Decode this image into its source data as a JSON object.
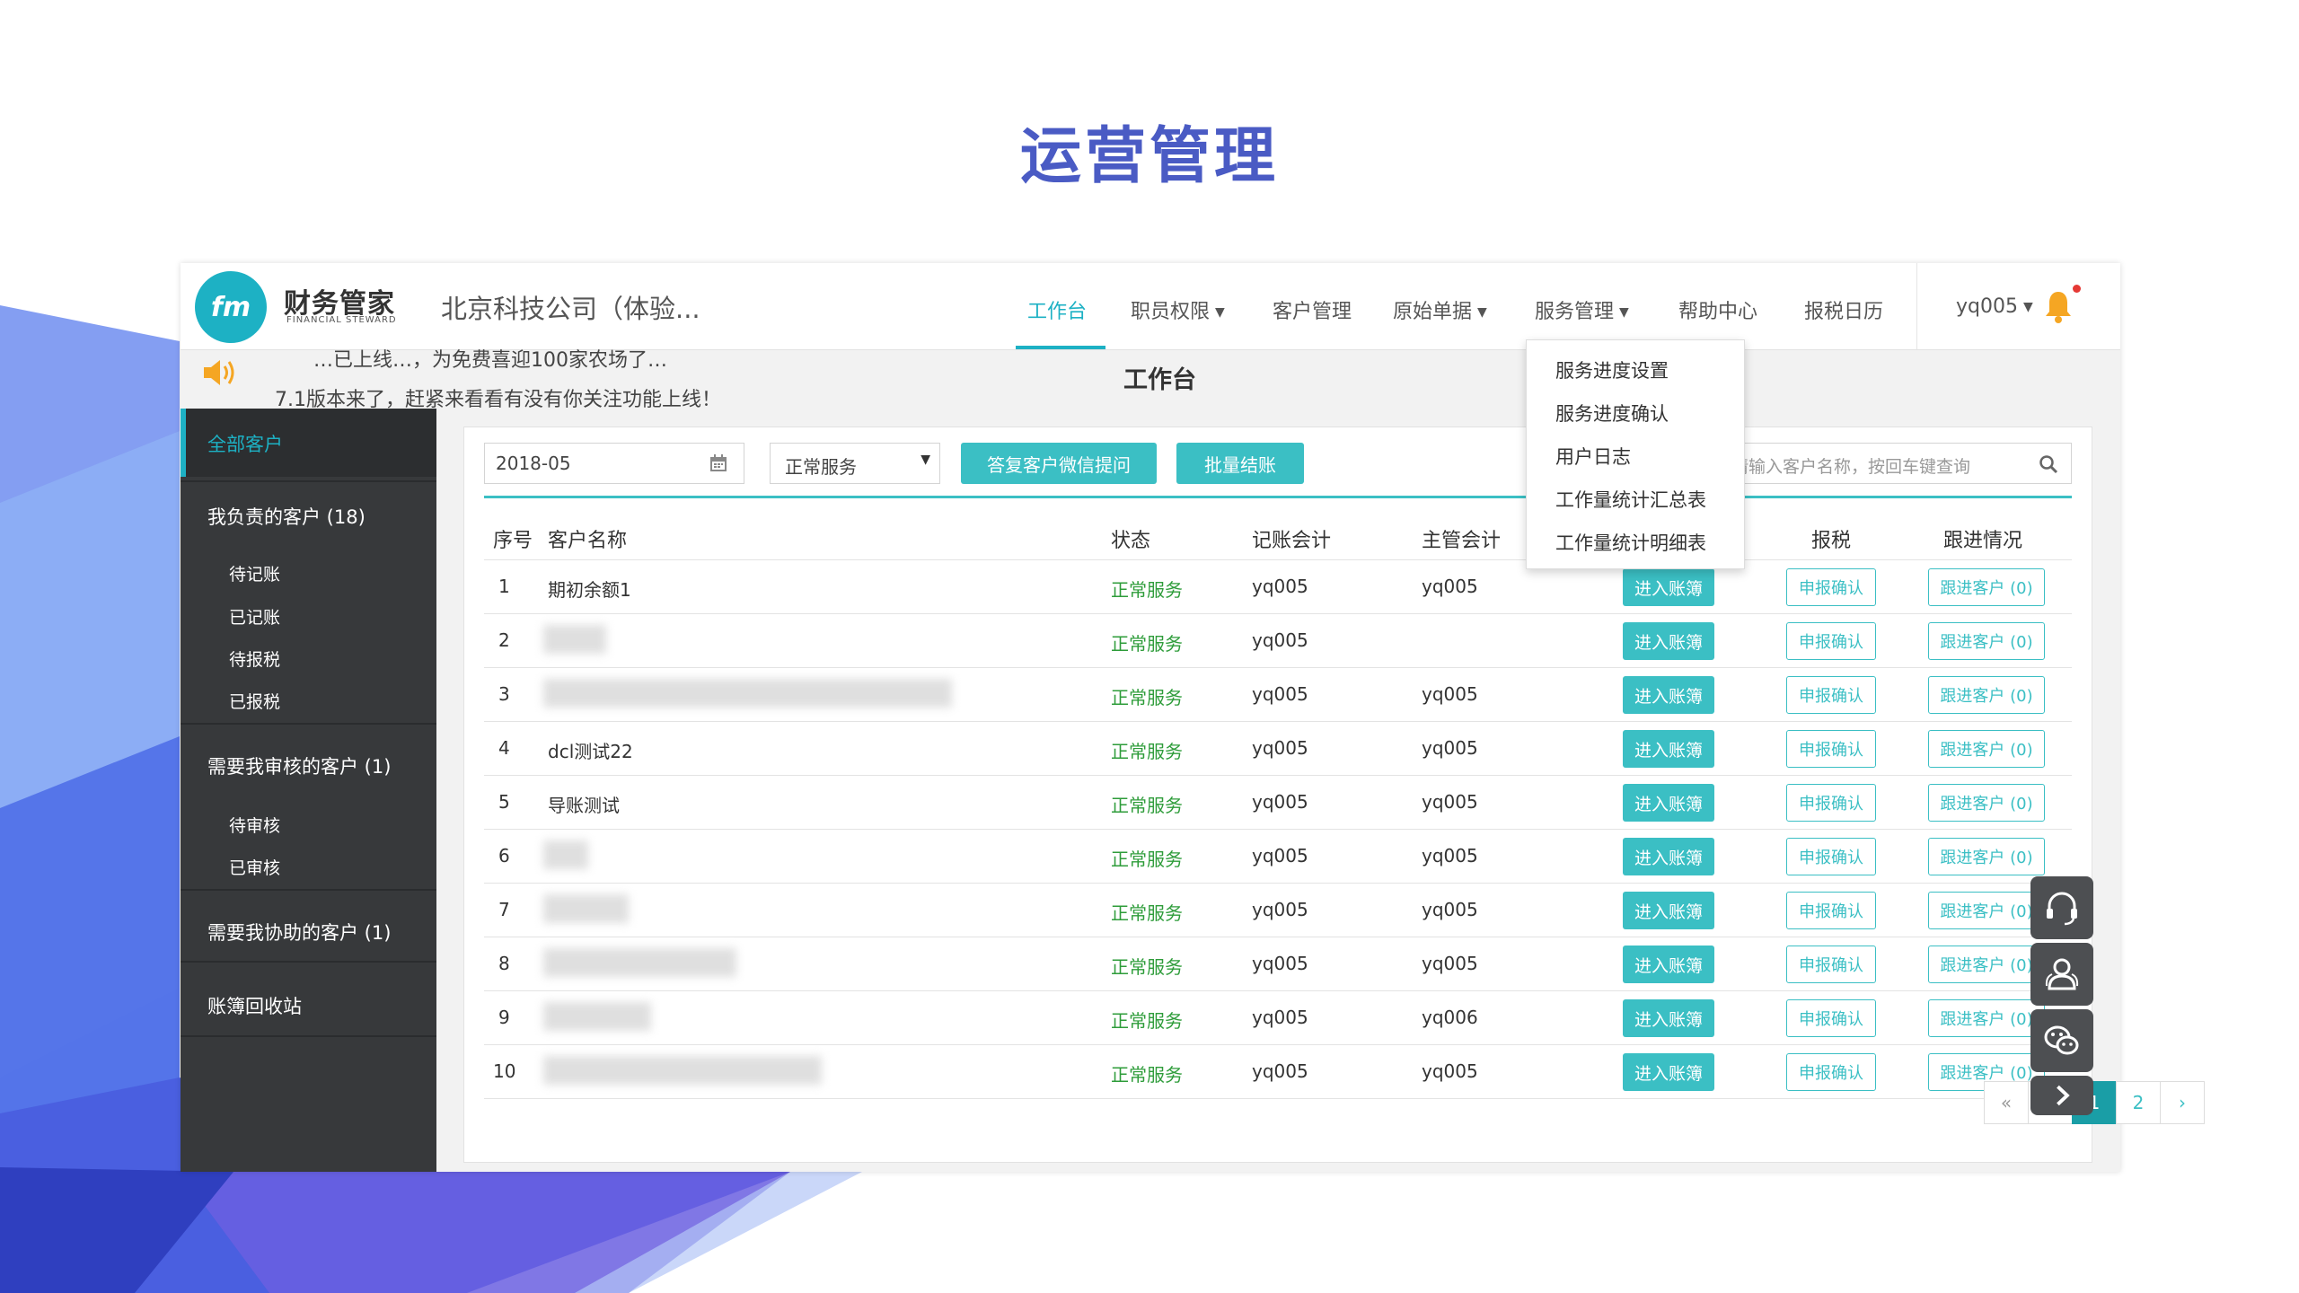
{
  "slide": {
    "title": "运营管理"
  },
  "brand": {
    "logo_text": "财务管家",
    "logo_sub": "FINANCIAL STEWARD",
    "company": "北京科技公司（体验..."
  },
  "nav": {
    "items": [
      {
        "label": "工作台",
        "dropdown": false
      },
      {
        "label": "职员权限",
        "dropdown": true
      },
      {
        "label": "客户管理",
        "dropdown": false
      },
      {
        "label": "原始单据",
        "dropdown": true
      },
      {
        "label": "服务管理",
        "dropdown": true
      },
      {
        "label": "帮助中心",
        "dropdown": false
      },
      {
        "label": "报税日历",
        "dropdown": false
      }
    ],
    "user": "yq005"
  },
  "announcement": {
    "line1": "…已上线…，为免费喜迎100家农场了…",
    "line2": "7.1版本来了，赶紧来看看有没有你关注功能上线！"
  },
  "page_heading": "工作台",
  "sidebar": {
    "active": "全部客户",
    "group1": "我负责的客户 (18)",
    "group1_items": [
      "待记账",
      "已记账",
      "待报税",
      "已报税"
    ],
    "group2": "需要我审核的客户 (1)",
    "group2_items": [
      "待审核",
      "已审核"
    ],
    "group3": "需要我协助的客户 (1)",
    "group4": "账簿回收站"
  },
  "toolbar": {
    "date_value": "2018-05",
    "service_select": "正常服务",
    "btn_wechat": "答复客户微信提问",
    "btn_batch": "批量结账",
    "search_placeholder": "请输入客户名称，按回车键查询"
  },
  "table": {
    "headers": {
      "no": "序号",
      "name": "客户名称",
      "status": "状态",
      "accountant": "记账会计",
      "supervisor": "主管会计",
      "tax": "报税",
      "followup": "跟进情况"
    },
    "rows": [
      {
        "no": "1",
        "name": "期初余额1",
        "status": "正常服务",
        "accountant": "yq005",
        "supervisor": "yq005"
      },
      {
        "no": "2",
        "name": "",
        "status": "正常服务",
        "accountant": "yq005",
        "supervisor": ""
      },
      {
        "no": "3",
        "name": "",
        "status": "正常服务",
        "accountant": "yq005",
        "supervisor": "yq005"
      },
      {
        "no": "4",
        "name": "dcl测试22",
        "status": "正常服务",
        "accountant": "yq005",
        "supervisor": "yq005"
      },
      {
        "no": "5",
        "name": "导账测试",
        "status": "正常服务",
        "accountant": "yq005",
        "supervisor": "yq005"
      },
      {
        "no": "6",
        "name": "",
        "status": "正常服务",
        "accountant": "yq005",
        "supervisor": "yq005"
      },
      {
        "no": "7",
        "name": "",
        "status": "正常服务",
        "accountant": "yq005",
        "supervisor": "yq005"
      },
      {
        "no": "8",
        "name": "",
        "status": "正常服务",
        "accountant": "yq005",
        "supervisor": "yq005"
      },
      {
        "no": "9",
        "name": "",
        "status": "正常服务",
        "accountant": "yq005",
        "supervisor": "yq006"
      },
      {
        "no": "10",
        "name": "",
        "status": "正常服务",
        "accountant": "yq005",
        "supervisor": "yq005"
      }
    ],
    "btn_enter": "进入账簿",
    "btn_declare": "申报确认",
    "btn_follow": "跟进客户 (0)"
  },
  "pagination": {
    "first": "«",
    "prev": "‹",
    "pages": [
      "1",
      "2"
    ],
    "current": "1",
    "next": "›",
    "last": "»"
  },
  "service_menu": [
    "服务进度设置",
    "服务进度确认",
    "用户日志",
    "工作量统计汇总表",
    "工作量统计明细表"
  ],
  "colors": {
    "accent": "#1db1c4",
    "title": "#4a5bc4",
    "status_ok": "#2e9c3a",
    "sidebar": "#37393b"
  }
}
